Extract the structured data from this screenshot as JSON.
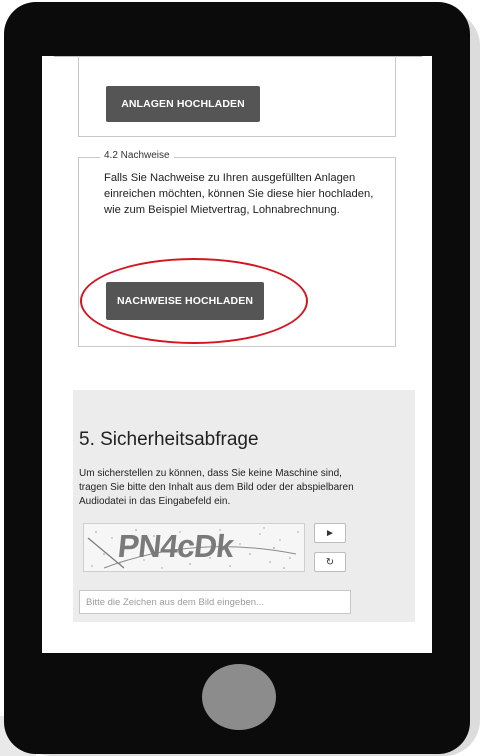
{
  "anlagen": {
    "upload_label": "ANLAGEN HOCHLADEN"
  },
  "nachweise": {
    "legend": "4.2 Nachweise",
    "description": "Falls Sie Nachweise zu Ihren ausgefüllten Anlagen einreichen möchten, können Sie diese hier hochladen, wie zum Beispiel Mietvertrag, Lohnabrechnung.",
    "upload_label": "NACHWEISE HOCHLADEN",
    "highlight_color": "#d31622"
  },
  "security": {
    "title": "5. Sicherheitsabfrage",
    "description": "Um sicherstellen zu können, dass Sie keine Maschine sind, tragen Sie bitte den Inhalt aus dem Bild oder der abspielbaren Audiodatei in das Eingabefeld ein.",
    "captcha_text": "PN4cDk",
    "play_icon": "play-icon",
    "refresh_icon": "refresh-icon",
    "input_placeholder": "Bitte die Zeichen aus dem Bild eingeben...",
    "input_value": ""
  },
  "colors": {
    "button_bg": "#555555",
    "section_bg": "#ececec",
    "device_body": "#0b0b0b",
    "home_button": "#8c8c8c"
  }
}
